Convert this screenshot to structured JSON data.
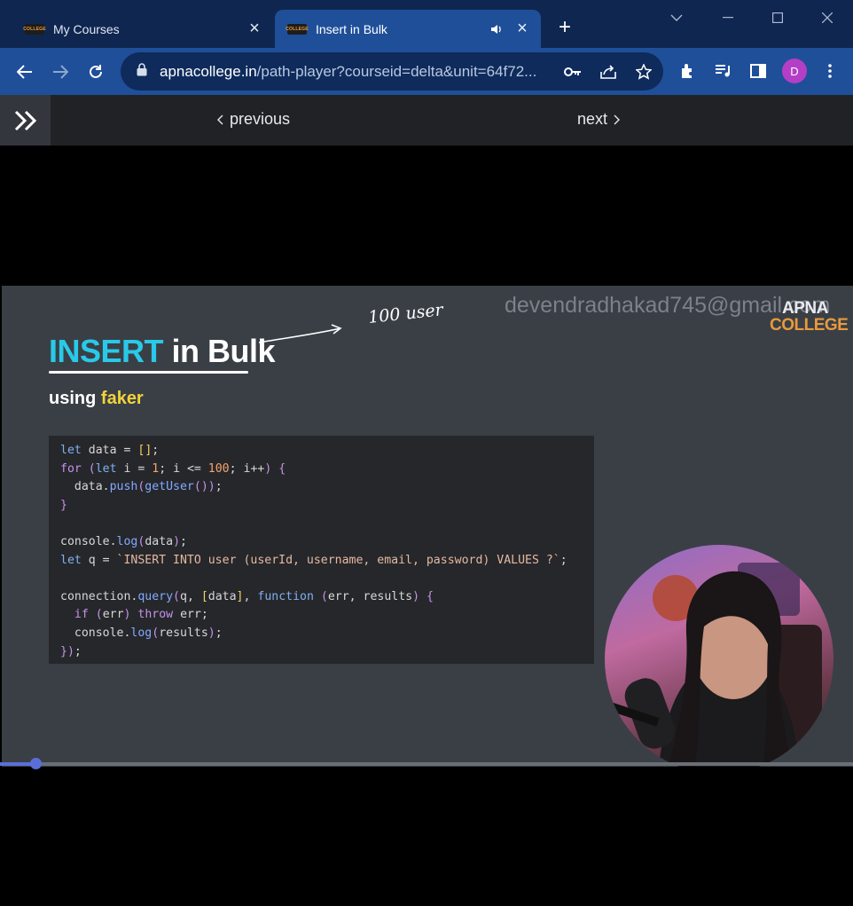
{
  "browser": {
    "tabs": [
      {
        "title": "My Courses",
        "favicon": "COLLEGE",
        "active": false
      },
      {
        "title": "Insert in Bulk",
        "favicon": "COLLEGE",
        "active": true
      }
    ],
    "address": {
      "host": "apnacollege.in",
      "rest": "/path-player?courseid=delta&unit=64f72..."
    },
    "profile_initial": "D",
    "icons": [
      "back-icon",
      "forward-icon",
      "reload-icon",
      "lock-icon",
      "key-icon",
      "share-icon",
      "star-icon",
      "extensions-icon",
      "media-queue-icon",
      "side-panel-icon",
      "kebab-menu-icon"
    ]
  },
  "page": {
    "prev_label": "previous",
    "next_label": "next"
  },
  "slide": {
    "watermark": "devendradhakad745@gmail.com",
    "logo_line1": "APNA",
    "logo_line2": "COLLEGE",
    "title_highlight": "INSERT",
    "title_rest": "in Bulk",
    "subtitle_prefix": "using",
    "subtitle_highlight": "faker",
    "annotation": "100 user",
    "code": [
      "let data = [];",
      "for (let i = 1; i <= 100; i++) {",
      "  data.push(getUser());",
      "}",
      "",
      "console.log(data);",
      "let q = `INSERT INTO user (userId, username, email, password) VALUES ?`;",
      "",
      "connection.query(q, [data], function (err, results) {",
      "  if (err) throw err;",
      "  console.log(results);",
      "});"
    ],
    "colors": {
      "title_accent": "#29c9e8",
      "subtitle_accent": "#f2d33b",
      "background": "#3a3f46"
    }
  },
  "player": {
    "progress_fraction": 0.042
  }
}
